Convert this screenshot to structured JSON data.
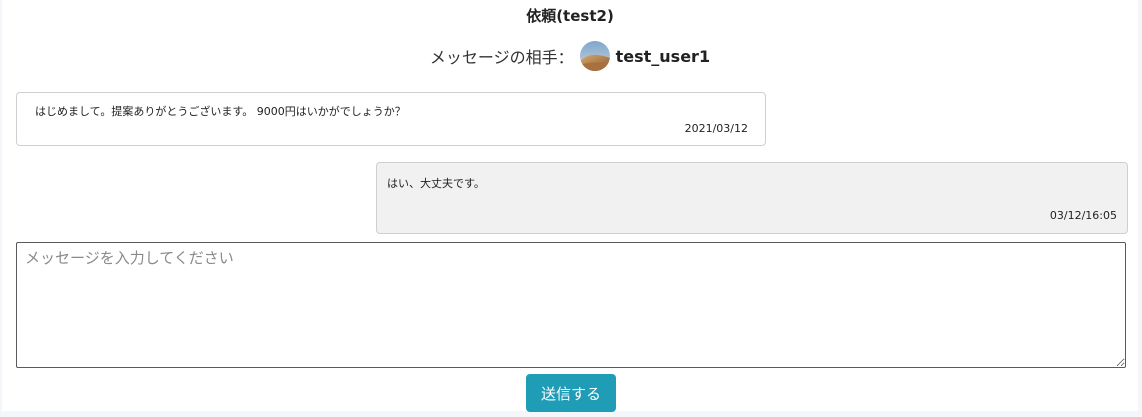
{
  "header": {
    "title": "依頼(test2)",
    "partner_label": "メッセージの相手：",
    "partner_name": "test_user1",
    "avatar_icon": "avatar-image"
  },
  "messages": [
    {
      "text": "はじめまして。提案ありがとうございます。 9000円はいかがでしょうか？",
      "date": "2021/03/12",
      "side": "left",
      "background": "#ffffff"
    },
    {
      "text": "はい、大丈夫です。",
      "date": "03/12/16:05",
      "side": "right",
      "background": "#f1f1f1"
    }
  ],
  "composer": {
    "placeholder": "メッセージを入力してください",
    "value": ""
  },
  "send_button": {
    "label": "送信する",
    "color": "#1f9cb6"
  }
}
